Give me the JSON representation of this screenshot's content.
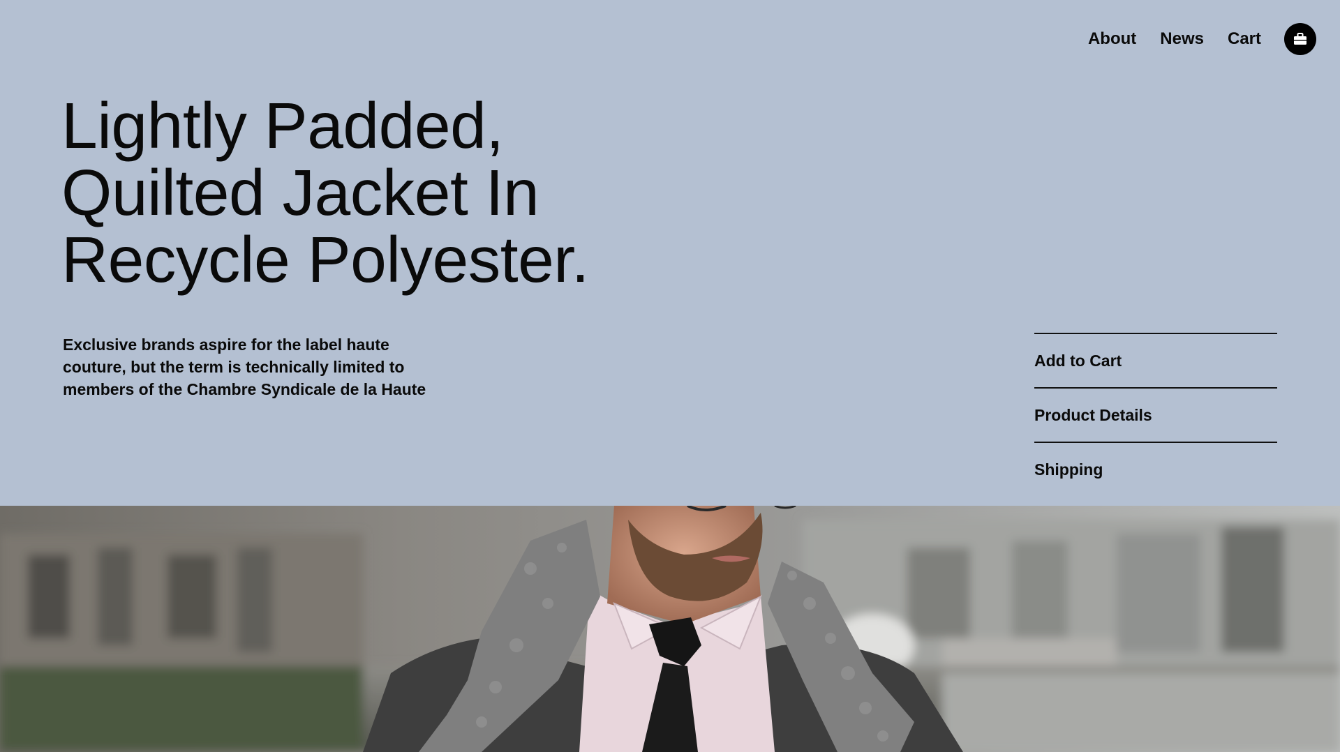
{
  "nav": {
    "about": "About",
    "news": "News",
    "cart": "Cart",
    "bag_icon": "shopping-bag-icon"
  },
  "hero": {
    "title_lines": [
      "Lightly Padded,",
      "Quilted Jacket In",
      "Recycle Polyester."
    ],
    "description_lines": [
      "Exclusive brands aspire for the label haute",
      "couture, but the term is technically limited to",
      "members of the Chambre Syndicale de la Haute"
    ]
  },
  "actions": {
    "add_to_cart": "Add to Cart",
    "product_details": "Product Details",
    "shipping": "Shipping"
  },
  "colors": {
    "background": "#b4c0d2",
    "text": "#0a0a0a",
    "bag_button": "#000000"
  }
}
